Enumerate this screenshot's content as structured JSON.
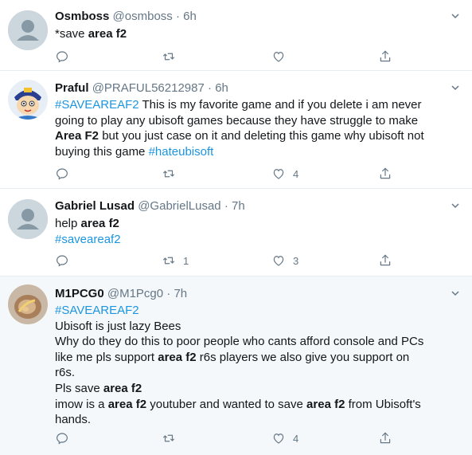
{
  "tweets": [
    {
      "name": "Osmboss",
      "handle": "@osmboss",
      "time": "6h",
      "lines": [
        [
          {
            "t": "*save "
          },
          {
            "t": "area f2",
            "b": true
          }
        ]
      ],
      "retweets": "",
      "likes": ""
    },
    {
      "name": "Praful",
      "handle": "@PRAFUL56212987",
      "time": "6h",
      "lines": [
        [
          {
            "t": "#SAVEAREAF2",
            "tag": true
          },
          {
            "t": " This is my favorite game and if you delete i am never"
          }
        ],
        [
          {
            "t": "going to play any ubisoft games because they have struggle to make"
          }
        ],
        [
          {
            "t": "Area F2",
            "b": true
          },
          {
            "t": " but you just case on it and deleting this game why ubisoft not"
          }
        ],
        [
          {
            "t": "buying this game "
          },
          {
            "t": "#hateubisoft",
            "tag": true
          }
        ]
      ],
      "retweets": "",
      "likes": "4"
    },
    {
      "name": "Gabriel Lusad",
      "handle": "@GabrielLusad",
      "time": "7h",
      "lines": [
        [
          {
            "t": "help "
          },
          {
            "t": "area f2",
            "b": true
          }
        ],
        [
          {
            "t": "#saveareaf2",
            "tag": true
          }
        ]
      ],
      "retweets": "1",
      "likes": "3"
    },
    {
      "name": "M1PCG0",
      "handle": "@M1Pcg0",
      "time": "7h",
      "lines": [
        [
          {
            "t": "#SAVEAREAF2",
            "tag": true
          }
        ],
        [
          {
            "t": "Ubisoft is just lazy Bees"
          }
        ],
        [
          {
            "t": "Why do they do this to poor people who cants afford console and PCs"
          }
        ],
        [
          {
            "t": "like me pls support "
          },
          {
            "t": "area f2",
            "b": true
          },
          {
            "t": " r6s players we also give you support on"
          }
        ],
        [
          {
            "t": "r6s."
          }
        ],
        [
          {
            "t": "Pls save "
          },
          {
            "t": "area f2",
            "b": true
          }
        ],
        [
          {
            "t": "imow is a "
          },
          {
            "t": "area f2",
            "b": true
          },
          {
            "t": " youtuber and wanted to save "
          },
          {
            "t": "area f2",
            "b": true
          },
          {
            "t": " from Ubisoft's"
          }
        ],
        [
          {
            "t": "hands."
          }
        ]
      ],
      "retweets": "",
      "likes": "4"
    }
  ],
  "icons": {
    "reply": "reply-icon",
    "retweet": "retweet-icon",
    "like": "heart-icon",
    "share": "share-icon",
    "more": "chevron-down-icon"
  },
  "colors": {
    "hashtag": "#1b95e0",
    "secondary": "#657786",
    "highlight_bg": "#f5f8fa",
    "border": "#e6ecf0"
  }
}
